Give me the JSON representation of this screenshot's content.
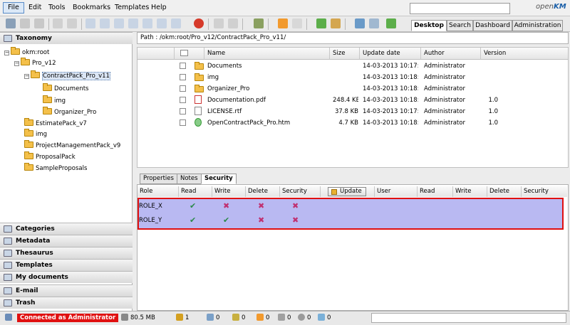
{
  "menubar": {
    "items": [
      "File",
      "Edit",
      "Tools",
      "Bookmarks",
      "Templates",
      "Help"
    ],
    "logo_prefix": "open",
    "logo_suffix": "KM"
  },
  "top_tabs": [
    "Desktop",
    "Search",
    "Dashboard",
    "Administration"
  ],
  "left": {
    "taxonomy_title": "Taxonomy",
    "tree": {
      "root": "okm:root",
      "pro_v12": "Pro_v12",
      "contractpack": "ContractPack_Pro_v11",
      "documents": "Documents",
      "img": "img",
      "organizer": "Organizer_Pro",
      "estimate": "EstimatePack_v7",
      "img2": "img",
      "projectmgmt": "ProjectManagementPack_v9",
      "proposal": "ProposalPack",
      "sample": "SampleProposals"
    },
    "sections": [
      "Categories",
      "Metadata",
      "Thesaurus",
      "Templates",
      "My documents",
      "E-mail",
      "Trash"
    ]
  },
  "path": "Path : /okm:root/Pro_v12/ContractPack_Pro_v11/",
  "file_table": {
    "headers": [
      "Name",
      "Size",
      "Update date",
      "Author",
      "Version"
    ],
    "rows": [
      {
        "name": "Documents",
        "size": "",
        "date": "14-03-2013 10:17:36",
        "author": "Administrator",
        "version": "",
        "type": "folder"
      },
      {
        "name": "img",
        "size": "",
        "date": "14-03-2013 10:18:55",
        "author": "Administrator",
        "version": "",
        "type": "folder"
      },
      {
        "name": "Organizer_Pro",
        "size": "",
        "date": "14-03-2013 10:18:19",
        "author": "Administrator",
        "version": "",
        "type": "folder"
      },
      {
        "name": "Documentation.pdf",
        "size": "248.4 KB",
        "date": "14-03-2013 10:18:19",
        "author": "Administrator",
        "version": "1.0",
        "type": "pdf"
      },
      {
        "name": "LICENSE.rtf",
        "size": "37.8 KB",
        "date": "14-03-2013 10:17:36",
        "author": "Administrator",
        "version": "1.0",
        "type": "doc"
      },
      {
        "name": "OpenContractPack_Pro.htm",
        "size": "4.7 KB",
        "date": "14-03-2013 10:18:19",
        "author": "Administrator",
        "version": "1.0",
        "type": "htm"
      }
    ]
  },
  "bottom_tabs": [
    "Properties",
    "Notes",
    "Security"
  ],
  "security": {
    "headers_left": [
      "Role",
      "Read",
      "Write",
      "Delete",
      "Security"
    ],
    "update_label": "Update",
    "headers_right": [
      "User",
      "Read",
      "Write",
      "Delete",
      "Security"
    ],
    "roles": [
      {
        "name": "ROLE_X",
        "read": true,
        "write": false,
        "delete": false,
        "security": false
      },
      {
        "name": "ROLE_Y",
        "read": true,
        "write": true,
        "delete": false,
        "security": false
      }
    ]
  },
  "status": {
    "connected": "Connected as Administrator",
    "memory": "80.5 MB",
    "counts": [
      "1",
      "0",
      "0",
      "0",
      "0",
      "0",
      "0"
    ]
  },
  "colors": {
    "highlight": "#e01010",
    "role_bg": "#b9b9f2",
    "check": "#2a8a4a",
    "cross": "#c03070"
  }
}
